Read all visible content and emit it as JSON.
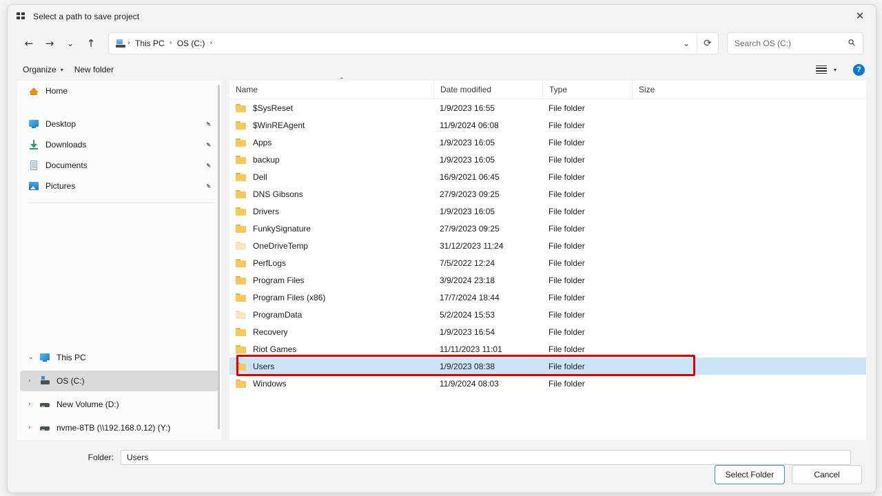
{
  "window": {
    "title": "Select a path to save project",
    "title_icon": "app-grid-icon",
    "close_label": "✕"
  },
  "navbar": {
    "back": "←",
    "forward": "→",
    "recent": "⌄",
    "up": "↑",
    "address_icon": "this-pc-icon",
    "breadcrumbs": [
      "This PC",
      "OS (C:)"
    ],
    "separator": "›",
    "dropdown": "⌄",
    "refresh": "⟳",
    "search_placeholder": "Search OS (C:)",
    "search_icon": "⚲"
  },
  "toolbar": {
    "organize_label": "Organize",
    "organize_caret": "▾",
    "new_folder_label": "New folder",
    "view_caret": "▾",
    "help_label": "?"
  },
  "sidebar": {
    "quick": [
      {
        "label": "Home",
        "icon": "home-icon",
        "pinned": false
      },
      {
        "label": "Desktop",
        "icon": "desktop-icon",
        "pinned": true
      },
      {
        "label": "Downloads",
        "icon": "downloads-icon",
        "pinned": true
      },
      {
        "label": "Documents",
        "icon": "documents-icon",
        "pinned": true
      },
      {
        "label": "Pictures",
        "icon": "pictures-icon",
        "pinned": true
      }
    ],
    "tree": [
      {
        "label": "This PC",
        "icon": "this-pc-icon",
        "chevron": "⌄",
        "selected": false
      },
      {
        "label": "OS (C:)",
        "icon": "os-drive-icon",
        "chevron": "›",
        "selected": true
      },
      {
        "label": "New Volume (D:)",
        "icon": "drive-icon",
        "chevron": "›",
        "selected": false
      },
      {
        "label": "nvme-8TB (\\\\192.168.0.12) (Y:)",
        "icon": "network-drive-icon",
        "chevron": "›",
        "selected": false
      }
    ],
    "pin_glyph": "📌"
  },
  "filelist": {
    "columns": [
      "Name",
      "Date modified",
      "Type",
      "Size"
    ],
    "sort_caret": "⌃",
    "rows": [
      {
        "name": "$SysReset",
        "date": "1/9/2023 16:55",
        "type": "File folder",
        "size": "",
        "dim": false,
        "selected": false
      },
      {
        "name": "$WinREAgent",
        "date": "11/9/2024 06:08",
        "type": "File folder",
        "size": "",
        "dim": false,
        "selected": false
      },
      {
        "name": "Apps",
        "date": "1/9/2023 16:05",
        "type": "File folder",
        "size": "",
        "dim": false,
        "selected": false
      },
      {
        "name": "backup",
        "date": "1/9/2023 16:05",
        "type": "File folder",
        "size": "",
        "dim": false,
        "selected": false
      },
      {
        "name": "Dell",
        "date": "16/9/2021 06:45",
        "type": "File folder",
        "size": "",
        "dim": false,
        "selected": false
      },
      {
        "name": "DNS Gibsons",
        "date": "27/9/2023 09:25",
        "type": "File folder",
        "size": "",
        "dim": false,
        "selected": false
      },
      {
        "name": "Drivers",
        "date": "1/9/2023 16:05",
        "type": "File folder",
        "size": "",
        "dim": false,
        "selected": false
      },
      {
        "name": "FunkySignature",
        "date": "27/9/2023 09:25",
        "type": "File folder",
        "size": "",
        "dim": false,
        "selected": false
      },
      {
        "name": "OneDriveTemp",
        "date": "31/12/2023 11:24",
        "type": "File folder",
        "size": "",
        "dim": true,
        "selected": false
      },
      {
        "name": "PerfLogs",
        "date": "7/5/2022 12:24",
        "type": "File folder",
        "size": "",
        "dim": false,
        "selected": false
      },
      {
        "name": "Program Files",
        "date": "3/9/2024 23:18",
        "type": "File folder",
        "size": "",
        "dim": false,
        "selected": false
      },
      {
        "name": "Program Files (x86)",
        "date": "17/7/2024 18:44",
        "type": "File folder",
        "size": "",
        "dim": false,
        "selected": false
      },
      {
        "name": "ProgramData",
        "date": "5/2/2024 15:53",
        "type": "File folder",
        "size": "",
        "dim": true,
        "selected": false
      },
      {
        "name": "Recovery",
        "date": "1/9/2023 16:54",
        "type": "File folder",
        "size": "",
        "dim": false,
        "selected": false
      },
      {
        "name": "Riot Games",
        "date": "11/11/2023 11:01",
        "type": "File folder",
        "size": "",
        "dim": false,
        "selected": false
      },
      {
        "name": "Users",
        "date": "1/9/2023 08:38",
        "type": "File folder",
        "size": "",
        "dim": false,
        "selected": true
      },
      {
        "name": "Windows",
        "date": "11/9/2024 08:03",
        "type": "File folder",
        "size": "",
        "dim": false,
        "selected": false
      }
    ]
  },
  "footer": {
    "folder_label": "Folder:",
    "folder_value": "Users",
    "select_button": "Select Folder",
    "cancel_button": "Cancel"
  },
  "annotation": {
    "color": "#e00000",
    "target_row": "Users"
  },
  "colors": {
    "selection_blue": "#cce4f7",
    "tree_selection_grey": "#dadada",
    "accent_blue": "#3b94d9",
    "annotation_red": "#e00000",
    "folder_yellow": "#f6c95a"
  }
}
